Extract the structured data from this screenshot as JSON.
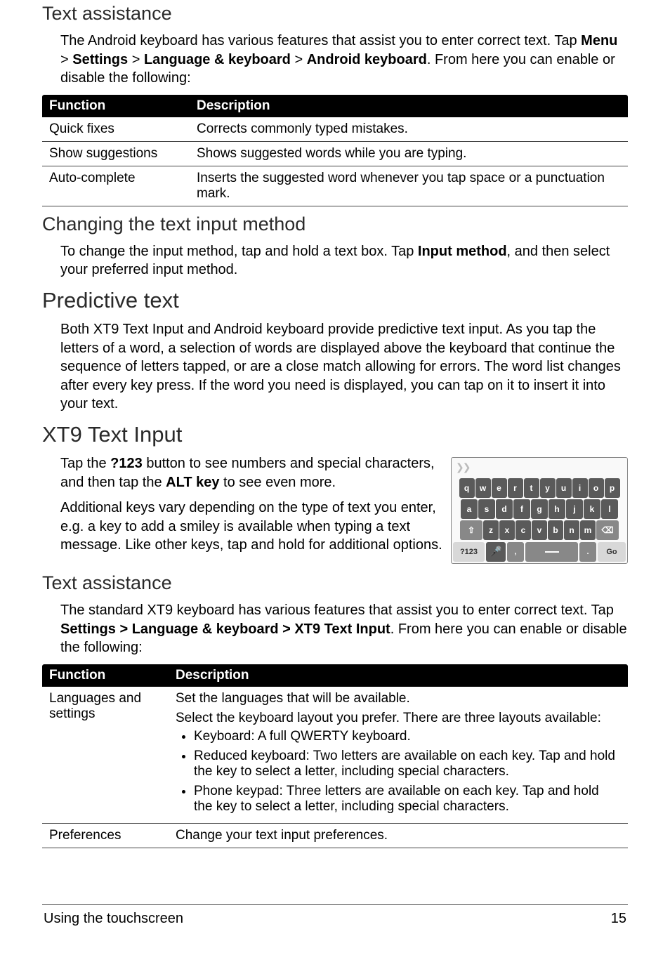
{
  "sections": {
    "textAssist1": {
      "heading": "Text assistance",
      "para_pre": "The Android keyboard has various features that assist you to enter correct text. Tap ",
      "path": [
        "Menu",
        "Settings",
        "Language & keyboard",
        "Android keyboard"
      ],
      "para_post": ". From here you can enable or disable the following:"
    },
    "table1": {
      "headers": {
        "func": "Function",
        "desc": "Description"
      },
      "rows": [
        {
          "func": "Quick fixes",
          "desc": "Corrects commonly typed mistakes."
        },
        {
          "func": "Show suggestions",
          "desc": "Shows suggested words while you are typing."
        },
        {
          "func": "Auto-complete",
          "desc": "Inserts the suggested word whenever you tap space or a punctuation mark."
        }
      ]
    },
    "changing": {
      "heading": "Changing the text input method",
      "para_pre": "To change the input method, tap and hold a text box. Tap ",
      "bold": "Input method",
      "para_post": ", and then select your preferred input method."
    },
    "predictive": {
      "heading": "Predictive text",
      "para": "Both XT9 Text Input and Android keyboard provide predictive text input. As you tap the letters of a word, a selection of words are displayed above the keyboard that continue the sequence of letters tapped, or are a close match allowing for errors. The word list changes after every key press. If the word you need is displayed, you can tap on it to insert it into your text."
    },
    "xt9": {
      "heading": "XT9 Text Input",
      "para1_pre": "Tap the ",
      "para1_b1": "?123",
      "para1_mid": " button to see numbers and special characters, and then tap the ",
      "para1_b2": "ALT key",
      "para1_post": " to see even more.",
      "para2": "Additional keys vary depending on the type of text you enter, e.g. a key to add a smiley is available when typing a text message. Like other keys, tap and hold for additional options."
    },
    "textAssist2": {
      "heading": "Text assistance",
      "para_pre": "The standard XT9 keyboard has various features that assist you to enter correct text. Tap ",
      "path_str": "Settings > Language & keyboard > XT9 Text Input",
      "para_post": ". From here you can enable or disable the following:"
    },
    "table2": {
      "headers": {
        "func": "Function",
        "desc": "Description"
      },
      "rows": {
        "r0": {
          "func": "Languages and settings",
          "line0": "Set the languages that will be available.",
          "line1": "Select the keyboard layout you prefer. There are three layouts available:",
          "bullets": [
            "Keyboard: A full QWERTY keyboard.",
            "Reduced keyboard: Two letters are available on each key. Tap and hold the key to select a letter, including special characters.",
            "Phone keypad: Three letters are available on each key. Tap and hold the key to select a letter, including special characters."
          ]
        },
        "r1": {
          "func": "Preferences",
          "desc": "Change your text input preferences."
        }
      }
    },
    "keyboard": {
      "row1": [
        "q",
        "w",
        "e",
        "r",
        "t",
        "y",
        "u",
        "i",
        "o",
        "p"
      ],
      "row2": [
        "a",
        "s",
        "d",
        "f",
        "g",
        "h",
        "j",
        "k",
        "l"
      ],
      "row3": {
        "shift": "⇧",
        "keys": [
          "z",
          "x",
          "c",
          "v",
          "b",
          "n",
          "m"
        ],
        "del": "⌫"
      },
      "row4": {
        "sym": "?123",
        "mic": "🎤",
        "comma": ",",
        "dot": ".",
        "go": "Go"
      }
    }
  },
  "footer": {
    "title": "Using the touchscreen",
    "page": "15"
  }
}
